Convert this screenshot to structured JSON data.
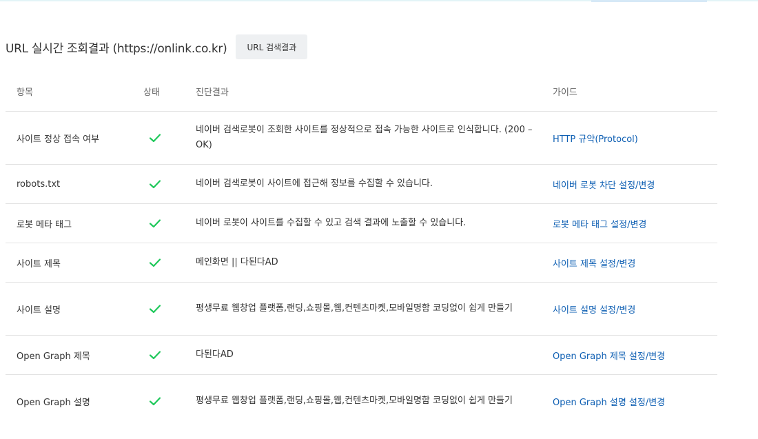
{
  "header": {
    "title": "URL 실시간 조회결과 (https://onlink.co.kr)",
    "button_label": "URL 검색결과"
  },
  "table": {
    "columns": [
      "항목",
      "상태",
      "진단결과",
      "가이드"
    ],
    "rows": [
      {
        "item": "사이트 정상 접속 여부",
        "status": "ok",
        "diagnosis": "네이버 검색로봇이 조회한 사이트를 정상적으로 접속 가능한 사이트로 인식합니다. (200 – OK)",
        "guide": "HTTP 규약(Protocol)"
      },
      {
        "item": "robots.txt",
        "status": "ok",
        "diagnosis": "네이버 검색로봇이 사이트에 접근해 정보를 수집할 수 있습니다.",
        "guide": "네이버 로봇 차단 설정/변경"
      },
      {
        "item": "로봇 메타 태그",
        "status": "ok",
        "diagnosis": "네이버 로봇이 사이트를 수집할 수 있고 검색 결과에 노출할 수 있습니다.",
        "guide": "로봇 메타 태그 설정/변경"
      },
      {
        "item": "사이트 제목",
        "status": "ok",
        "diagnosis": "메인화면 || 다된다AD",
        "guide": "사이트 제목 설정/변경"
      },
      {
        "item": "사이트 설명",
        "status": "ok",
        "diagnosis": "평생무료 웹창업 플랫폼,랜딩,쇼핑몰,웹,컨텐츠마켓,모바일명함 코딩없이 쉽게 만들기",
        "guide": "사이트 설명 설정/변경"
      },
      {
        "item": "Open Graph 제목",
        "status": "ok",
        "diagnosis": "다된다AD",
        "guide": "Open Graph 제목 설정/변경"
      },
      {
        "item": "Open Graph 설명",
        "status": "ok",
        "diagnosis": "평생무료 웹창업 플랫폼,랜딩,쇼핑몰,웹,컨텐츠마켓,모바일명함 코딩없이 쉽게 만들기",
        "guide": "Open Graph 설명 설정/변경"
      }
    ]
  },
  "colors": {
    "check": "#1ec85a",
    "link": "#0e5fb3",
    "border": "#e2e2e2",
    "button_bg": "#eef0f2"
  },
  "icons": {
    "status_ok": "check-icon"
  }
}
